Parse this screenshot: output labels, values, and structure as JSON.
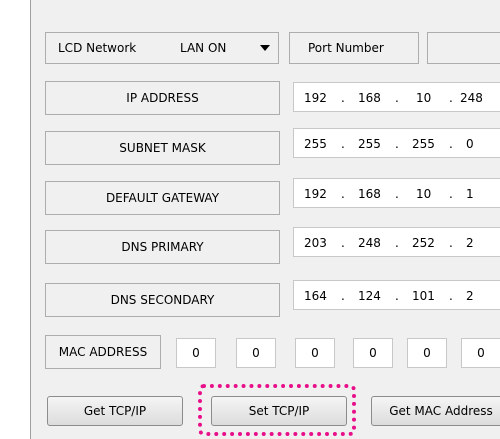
{
  "network": {
    "label": "LCD Network",
    "lan_select_value": "LAN ON",
    "port_label": "Port Number",
    "port_value": ""
  },
  "rows": [
    {
      "label": "IP ADDRESS",
      "octets": [
        "192",
        "168",
        "10",
        "248"
      ]
    },
    {
      "label": "SUBNET MASK",
      "octets": [
        "255",
        "255",
        "255",
        "0"
      ]
    },
    {
      "label": "DEFAULT GATEWAY",
      "octets": [
        "192",
        "168",
        "10",
        "1"
      ]
    },
    {
      "label": "DNS PRIMARY",
      "octets": [
        "203",
        "248",
        "252",
        "2"
      ]
    },
    {
      "label": "DNS SECONDARY",
      "octets": [
        "164",
        "124",
        "101",
        "2"
      ]
    }
  ],
  "separator": ".",
  "mac": {
    "label": "MAC ADDRESS",
    "bytes": [
      "0",
      "0",
      "0",
      "0",
      "0",
      "0"
    ]
  },
  "buttons": {
    "get_tcp": "Get TCP/IP",
    "set_tcp": "Set TCP/IP",
    "get_mac": "Get MAC Address"
  },
  "colors": {
    "highlight": "#e8108a",
    "panel": "#f0f0f0"
  },
  "icons": {
    "dropdown": "chevron-down-icon"
  }
}
